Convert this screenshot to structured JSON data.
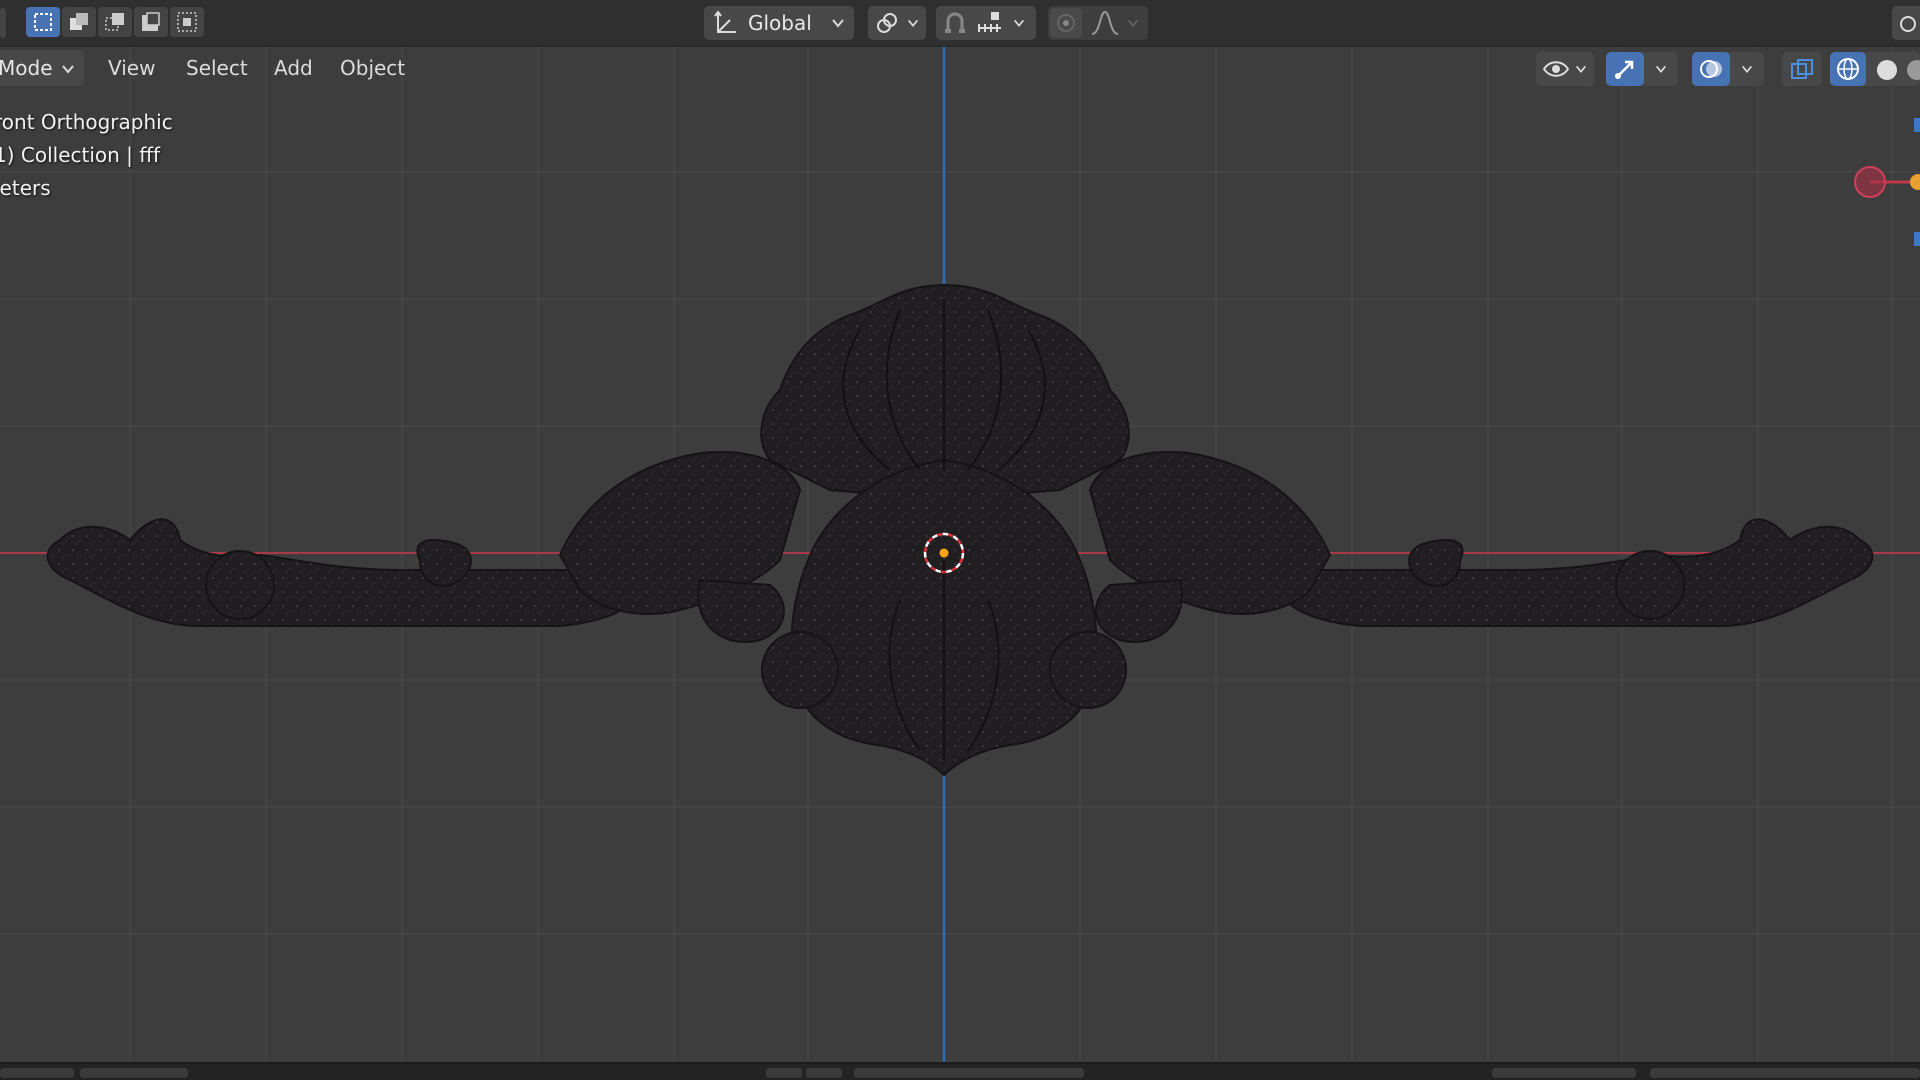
{
  "tool_header": {
    "select_modes": [
      "select-box-new",
      "select-box-extend",
      "select-box-subtract",
      "select-box-invert",
      "select-box-intersect"
    ],
    "transform_orientation": "Global"
  },
  "viewport_header": {
    "mode_label": "Mode",
    "menu_view": "View",
    "menu_select": "Select",
    "menu_add": "Add",
    "menu_object": "Object"
  },
  "overlay": {
    "view_name": "ront Orthographic",
    "collection": "1) Collection | fff",
    "units": "leters"
  },
  "colors": {
    "accent": "#4772b3",
    "x_axis": "#b03a48",
    "z_axis": "#2f6bb8",
    "background": "#3d3d3d",
    "header": "#2f2f2f",
    "object": "#1f1d1f"
  }
}
